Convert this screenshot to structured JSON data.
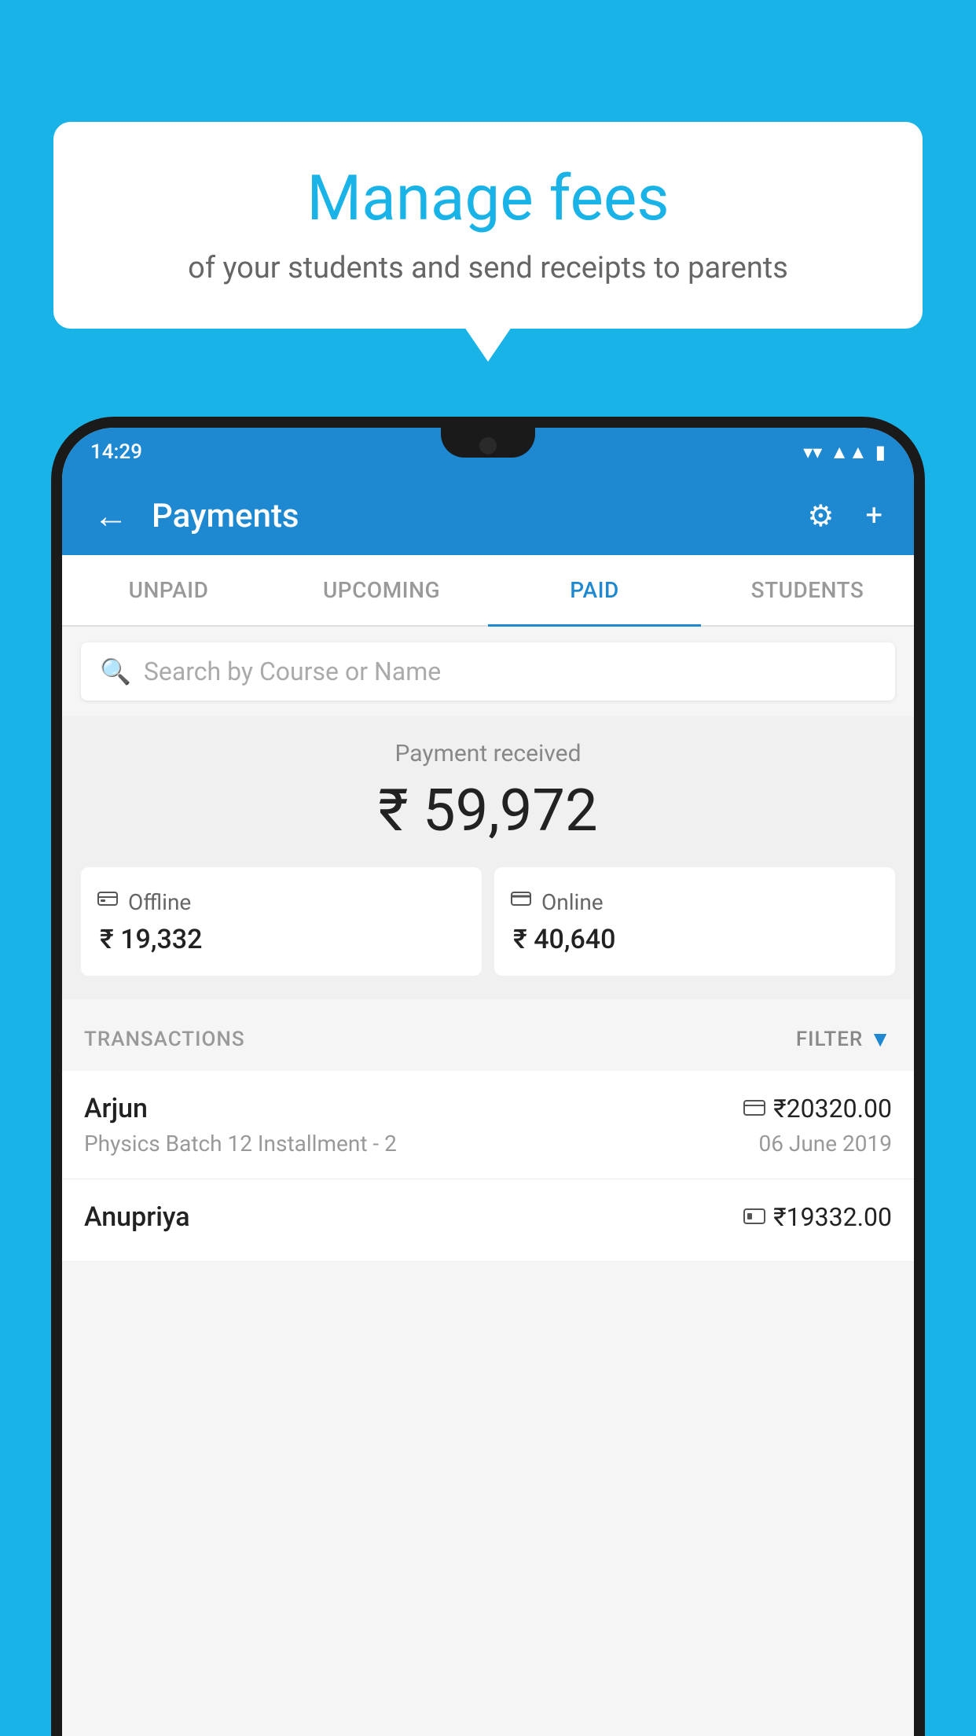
{
  "background_color": "#1ab3e8",
  "bubble": {
    "title": "Manage fees",
    "subtitle": "of your students and send receipts to parents"
  },
  "status_bar": {
    "time": "14:29",
    "wifi_icon": "▼",
    "signal_icon": "▲",
    "battery_icon": "▮"
  },
  "app_bar": {
    "back_icon": "←",
    "title": "Payments",
    "gear_icon": "⚙",
    "plus_icon": "+"
  },
  "tabs": [
    {
      "label": "UNPAID",
      "active": false
    },
    {
      "label": "UPCOMING",
      "active": false
    },
    {
      "label": "PAID",
      "active": true
    },
    {
      "label": "STUDENTS",
      "active": false
    }
  ],
  "search": {
    "placeholder": "Search by Course or Name",
    "icon": "🔍"
  },
  "payment_summary": {
    "label": "Payment received",
    "amount": "₹ 59,972",
    "offline": {
      "label": "Offline",
      "amount": "₹ 19,332",
      "icon": "💳"
    },
    "online": {
      "label": "Online",
      "amount": "₹ 40,640",
      "icon": "💳"
    }
  },
  "transactions_section": {
    "label": "TRANSACTIONS",
    "filter_label": "FILTER",
    "filter_icon": "▼"
  },
  "transactions": [
    {
      "name": "Arjun",
      "amount": "₹20320.00",
      "course": "Physics Batch 12 Installment - 2",
      "date": "06 June 2019",
      "payment_type": "card"
    },
    {
      "name": "Anupriya",
      "amount": "₹19332.00",
      "course": "",
      "date": "",
      "payment_type": "cash"
    }
  ]
}
